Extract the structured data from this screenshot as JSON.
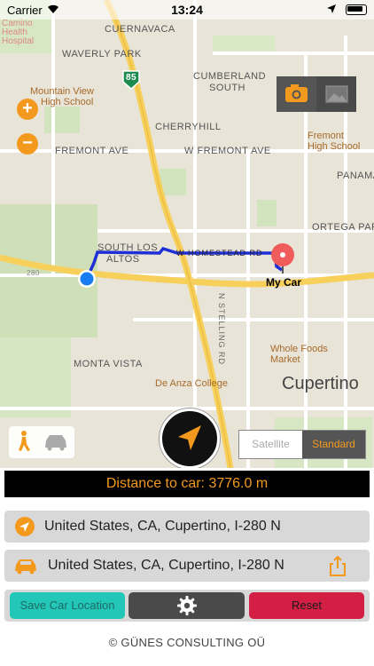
{
  "status_bar": {
    "carrier": "Carrier",
    "time": "13:24"
  },
  "map": {
    "labels": {
      "cuernavaca": "CUERNAVACA",
      "waverly_park": "WAVERLY PARK",
      "cumberland": "CUMBERLAND",
      "cumberland_south": "SOUTH",
      "cherryhill": "CHERRYHILL",
      "fremont_ave_w": "FREMONT AVE",
      "fremont_ave_e": "W FREMONT AVE",
      "panama": "PANAMA",
      "ortega_park": "ORTEGA PARK",
      "south_los": "SOUTH LOS",
      "altos": "ALTOS",
      "monta_vista": "MONTA VISTA",
      "homestead": "W HOMESTEAD RD",
      "stelling": "N STELLING RD",
      "highway_85": "85",
      "highway_280": "280",
      "hospital_1": "Camino",
      "hospital_2": "Health",
      "hospital_3": "Hospital"
    },
    "pois": {
      "mv_high_1": "Mountain View",
      "mv_high_2": "High School",
      "fremont_high_1": "Fremont",
      "fremont_high_2": "High School",
      "whole_foods_1": "Whole Foods",
      "whole_foods_2": "Market",
      "de_anza": "De Anza College",
      "my_car": "My Car",
      "city": "Cupertino"
    },
    "controls": {
      "zoom_in": "+",
      "zoom_out": "−"
    },
    "map_type": {
      "satellite": "Satellite",
      "standard": "Standard",
      "selected": "Standard"
    }
  },
  "distance": {
    "text": "Distance to car: 3776.0 m"
  },
  "current_location": {
    "address": "United States, CA, Cupertino, I-280 N"
  },
  "car_location": {
    "address": "United States, CA, Cupertino, I-280 N"
  },
  "buttons": {
    "save": "Save Car Location",
    "reset": "Reset"
  },
  "colors": {
    "accent": "#f39a1e",
    "save": "#22c7b8",
    "reset": "#d41f45",
    "route": "#1f2fd6",
    "pin": "#f05c5c",
    "location": "#1a7cf2"
  },
  "footer": {
    "copyright": "© GÜNES CONSULTING OÜ"
  }
}
